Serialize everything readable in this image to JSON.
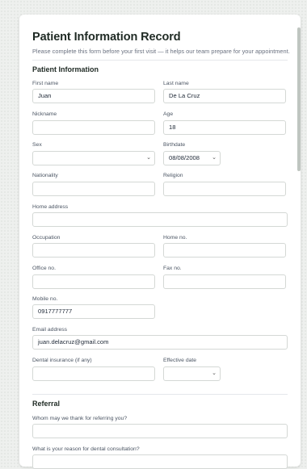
{
  "form": {
    "title": "Patient Information Record",
    "intro": "Please complete this form before your first visit — it helps our team prepare for your appointment.",
    "section_patient": "Patient Information",
    "section_referral": "Referral",
    "fields": {
      "first_name": {
        "label": "First name",
        "value": "Juan"
      },
      "last_name": {
        "label": "Last name",
        "value": "De La Cruz"
      },
      "nickname": {
        "label": "Nickname",
        "value": ""
      },
      "age": {
        "label": "Age",
        "value": "18"
      },
      "sex": {
        "label": "Sex",
        "value": ""
      },
      "birthdate": {
        "label": "Birthdate",
        "value": "08/08/2008"
      },
      "nationality": {
        "label": "Nationality",
        "value": ""
      },
      "religion": {
        "label": "Religion",
        "value": ""
      },
      "home_address": {
        "label": "Home address",
        "value": ""
      },
      "occupation": {
        "label": "Occupation",
        "value": ""
      },
      "home_no": {
        "label": "Home no.",
        "value": ""
      },
      "office_no": {
        "label": "Office no.",
        "value": ""
      },
      "fax_no": {
        "label": "Fax no.",
        "value": ""
      },
      "mobile_no": {
        "label": "Mobile no.",
        "value": "0917777777"
      },
      "email": {
        "label": "Email address",
        "value": "juan.delacruz@gmail.com"
      },
      "dental_insurance": {
        "label": "Dental insurance (if any)",
        "value": ""
      },
      "effective_date": {
        "label": "Effective date",
        "value": ""
      },
      "referred_by": {
        "label": "Whom may we thank for referring you?",
        "value": ""
      },
      "consult_reason": {
        "label": "What is your reason for dental consultation?",
        "value": ""
      }
    }
  },
  "icons": {
    "dropdown": "chevron-down-icon"
  }
}
